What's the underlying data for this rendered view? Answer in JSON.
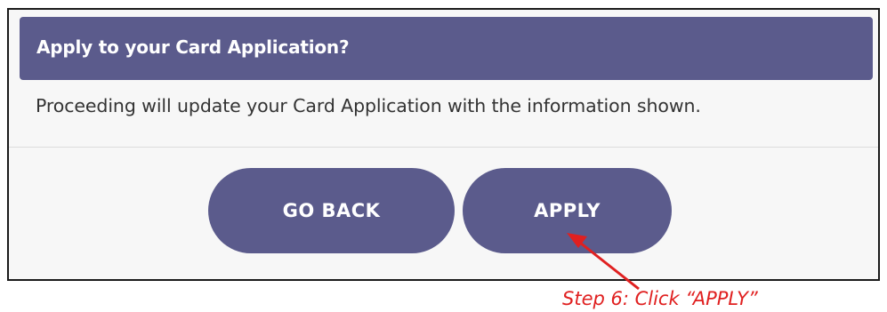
{
  "dialog": {
    "title": "Apply to your Card Application?",
    "message": "Proceeding will update your Card Application with the information shown.",
    "buttons": {
      "go_back_label": "GO BACK",
      "apply_label": "APPLY"
    }
  },
  "annotation": {
    "caption": "Step 6: Click “APPLY”",
    "color": "#e02020"
  },
  "colors": {
    "accent": "#5b5b8c",
    "panel_background": "#f7f7f7"
  }
}
